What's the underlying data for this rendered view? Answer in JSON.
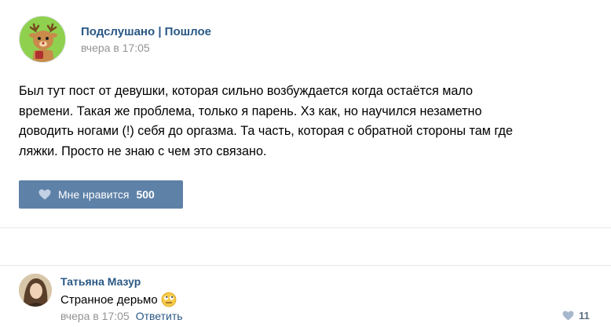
{
  "post": {
    "group_name": "Подслушано | Пошлое",
    "time": "вчера в 17:05",
    "text_lines": [
      "Был тут пост от девушки, которая сильно возбуждается когда остаётся мало",
      "времени. Такая же проблема, только я парень. Хз как, но научился незаметно",
      "доводить ногами (!) себя до оргазма. Та часть, которая с обратной стороны там где",
      "ляжки. Просто не знаю с чем это связано."
    ],
    "like_label": "Мне нравится",
    "like_count": "500",
    "accent_color": "#5e81a8",
    "link_color": "#2a5885"
  },
  "comment": {
    "author": "Татьяна Мазур",
    "text": "Странное дерьмо",
    "emoji_icon": "face-with-rolling-eyes-icon",
    "time": "вчера в 17:05",
    "reply_label": "Ответить",
    "like_count": "11"
  }
}
